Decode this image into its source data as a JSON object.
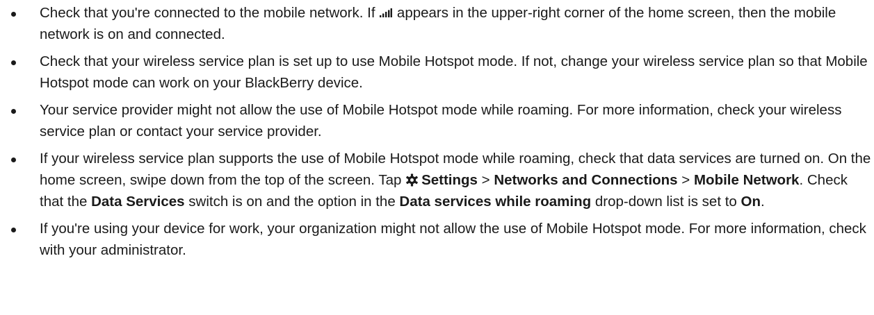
{
  "bullets": [
    {
      "before_icon": "Check that you're connected to the mobile network. If ",
      "icon": "signal-bars-icon",
      "after_icon": " appears in the upper-right corner of the home screen, then the mobile network is on and connected."
    },
    {
      "text": "Check that your wireless service plan is set up to use Mobile Hotspot mode. If not, change your wireless service plan so that Mobile Hotspot mode can work on your BlackBerry device."
    },
    {
      "text": "Your service provider might not allow the use of Mobile Hotspot mode while roaming. For more information, check your wireless service plan or contact your service provider."
    },
    {
      "t1": "If your wireless service plan supports the use of Mobile Hotspot mode while roaming, check that data services are turned on. On the home screen, swipe down from the top of the screen. Tap ",
      "icon": "gear-icon",
      "settings": "Settings",
      "sep1": " > ",
      "networks": "Networks and Connections",
      "sep2": " > ",
      "mobile_network": "Mobile Network",
      "t2": ". Check that the ",
      "data_services": "Data Services",
      "t3": " switch is on and the option in the ",
      "roaming": "Data services while roaming",
      "t4": " drop-down list is set to ",
      "on": "On",
      "t5": "."
    },
    {
      "text": "If you're using your device for work, your organization might not allow the use of Mobile Hotspot mode. For more information, check with your administrator."
    }
  ]
}
